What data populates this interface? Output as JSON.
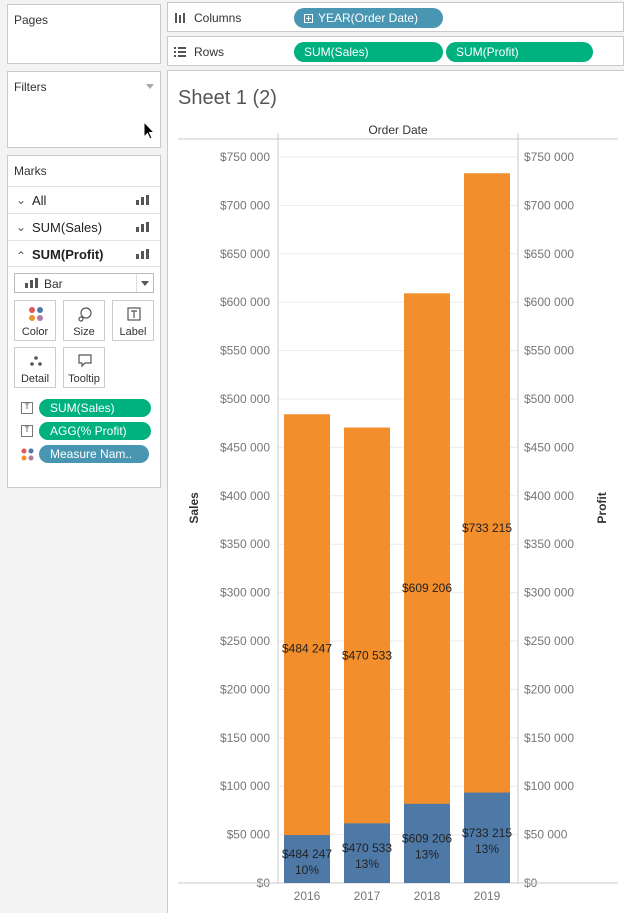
{
  "pages": {
    "title": "Pages"
  },
  "filters": {
    "title": "Filters"
  },
  "marks": {
    "title": "Marks",
    "rows": [
      {
        "label": "All",
        "expanded": false
      },
      {
        "label": "SUM(Sales)",
        "expanded": false
      },
      {
        "label": "SUM(Profit)",
        "expanded": true
      }
    ],
    "mark_type": "Bar",
    "buttons": {
      "color": "Color",
      "size": "Size",
      "label": "Label",
      "detail": "Detail",
      "tooltip": "Tooltip"
    },
    "pills": [
      {
        "icon": "text-icon",
        "label": "SUM(Sales)"
      },
      {
        "icon": "text-icon",
        "label": "AGG(% Profit)"
      },
      {
        "icon": "color-icon",
        "label": "Measure Nam.."
      }
    ]
  },
  "shelves": {
    "columns_label": "Columns",
    "columns_pill": "YEAR(Order Date)",
    "rows_label": "Rows",
    "rows_pills": [
      "SUM(Sales)",
      "SUM(Profit)"
    ]
  },
  "sheet": {
    "title": "Sheet 1 (2)"
  },
  "chart_data": {
    "type": "bar",
    "header": "Order Date",
    "categories": [
      "2016",
      "2017",
      "2018",
      "2019"
    ],
    "ylabel_left": "Sales",
    "ylabel_right": "Profit",
    "ylim": [
      0,
      775000
    ],
    "y_ticks": [
      "$0",
      "$50 000",
      "$100 000",
      "$150 000",
      "$200 000",
      "$250 000",
      "$300 000",
      "$350 000",
      "$400 000",
      "$450 000",
      "$500 000",
      "$550 000",
      "$600 000",
      "$650 000",
      "$700 000",
      "$750 000"
    ],
    "series": [
      {
        "name": "Sales",
        "color": "#f28e2b",
        "values": [
          484247,
          470533,
          609206,
          733215
        ],
        "labels": [
          "$484 247",
          "$470 533",
          "$609 206",
          "$733 215"
        ]
      },
      {
        "name": "Profit",
        "color": "#4e79a7",
        "values": [
          49544,
          61619,
          81795,
          93439
        ],
        "labels": [
          "$484 247",
          "$470 533",
          "$609 206",
          "$733 215"
        ],
        "sub_labels": [
          "10%",
          "13%",
          "13%",
          "13%"
        ]
      }
    ],
    "colors": {
      "grid": "#ebebeb",
      "axis": "#c8c8c8",
      "tick_text": "#777777"
    }
  }
}
